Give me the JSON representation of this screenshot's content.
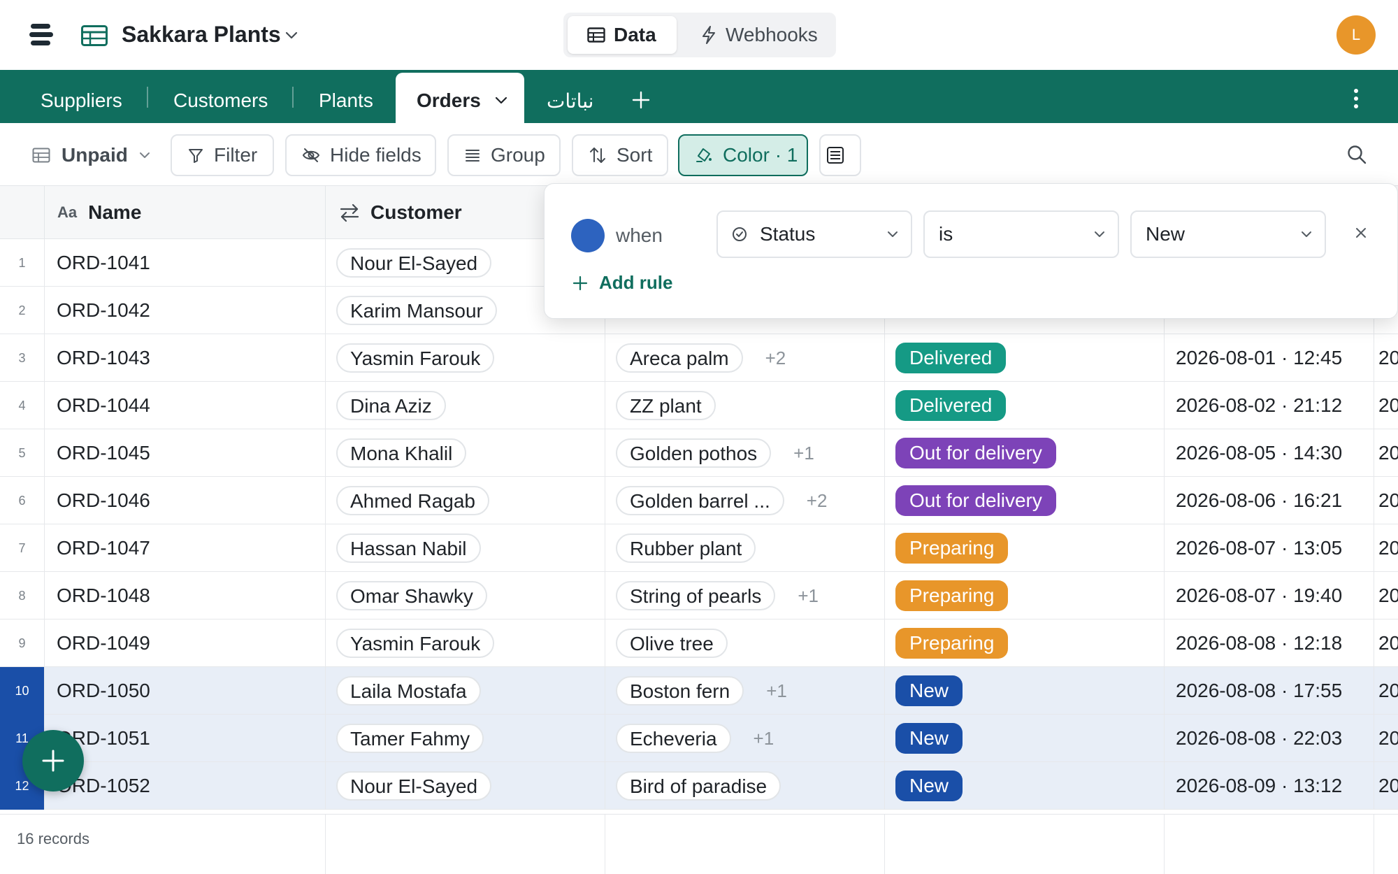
{
  "app": {
    "base_title": "Sakkara Plants",
    "avatar_initial": "L",
    "segments": {
      "data": "Data",
      "webhooks": "Webhooks"
    }
  },
  "tabs": {
    "items": [
      "Suppliers",
      "Customers",
      "Plants"
    ],
    "active": "Orders",
    "after": "نباتات"
  },
  "toolbar": {
    "view_name": "Unpaid",
    "filter": "Filter",
    "hide_fields": "Hide fields",
    "group": "Group",
    "sort": "Sort",
    "color": "Color · 1"
  },
  "grid": {
    "columns": {
      "name": "Name",
      "customer": "Customer",
      "name_icon_text": "Aa"
    },
    "rows": [
      {
        "num": "1",
        "name": "ORD-1041",
        "customer": "Nour El-Sayed",
        "plant": "",
        "more": "",
        "status": "",
        "date": "",
        "extra": ""
      },
      {
        "num": "2",
        "name": "ORD-1042",
        "customer": "Karim Mansour",
        "plant": "",
        "more": "",
        "status": "",
        "date": "",
        "extra": ""
      },
      {
        "num": "3",
        "name": "ORD-1043",
        "customer": "Yasmin Farouk",
        "plant": "Areca palm",
        "more": "+2",
        "status": "Delivered",
        "date": "2026-08-01 · 12:45",
        "extra": "20"
      },
      {
        "num": "4",
        "name": "ORD-1044",
        "customer": "Dina Aziz",
        "plant": "ZZ plant",
        "more": "",
        "status": "Delivered",
        "date": "2026-08-02 · 21:12",
        "extra": "20"
      },
      {
        "num": "5",
        "name": "ORD-1045",
        "customer": "Mona Khalil",
        "plant": "Golden pothos",
        "more": "+1",
        "status": "Out for delivery",
        "date": "2026-08-05 · 14:30",
        "extra": "20"
      },
      {
        "num": "6",
        "name": "ORD-1046",
        "customer": "Ahmed Ragab",
        "plant": "Golden barrel ...",
        "more": "+2",
        "status": "Out for delivery",
        "date": "2026-08-06 · 16:21",
        "extra": "20"
      },
      {
        "num": "7",
        "name": "ORD-1047",
        "customer": "Hassan Nabil",
        "plant": "Rubber plant",
        "more": "",
        "status": "Preparing",
        "date": "2026-08-07 · 13:05",
        "extra": "20"
      },
      {
        "num": "8",
        "name": "ORD-1048",
        "customer": "Omar Shawky",
        "plant": "String of pearls",
        "more": "+1",
        "status": "Preparing",
        "date": "2026-08-07 · 19:40",
        "extra": "20"
      },
      {
        "num": "9",
        "name": "ORD-1049",
        "customer": "Yasmin Farouk",
        "plant": "Olive tree",
        "more": "",
        "status": "Preparing",
        "date": "2026-08-08 · 12:18",
        "extra": "20"
      },
      {
        "num": "10",
        "name": "ORD-1050",
        "customer": "Laila Mostafa",
        "plant": "Boston fern",
        "more": "+1",
        "status": "New",
        "date": "2026-08-08 · 17:55",
        "extra": "20"
      },
      {
        "num": "11",
        "name": "ORD-1051",
        "customer": "Tamer Fahmy",
        "plant": "Echeveria",
        "more": "+1",
        "status": "New",
        "date": "2026-08-08 · 22:03",
        "extra": "20"
      },
      {
        "num": "12",
        "name": "ORD-1052",
        "customer": "Nour El-Sayed",
        "plant": "Bird of paradise",
        "more": "",
        "status": "New",
        "date": "2026-08-09 · 13:12",
        "extra": "20"
      }
    ],
    "status_colors": {
      "Delivered": "#159a85",
      "Out for delivery": "#7d43b8",
      "Preparing": "#e8962a",
      "New": "#1a4fa8"
    },
    "record_count": "16 records"
  },
  "color_popover": {
    "swatch_color": "#2d63bf",
    "when_label": "when",
    "field": "Status",
    "operator": "is",
    "value": "New",
    "add_rule": "Add rule"
  },
  "colors": {
    "brand": "#106e5e",
    "highlight_row": "#e8eef7",
    "accent": "#e8962a"
  }
}
